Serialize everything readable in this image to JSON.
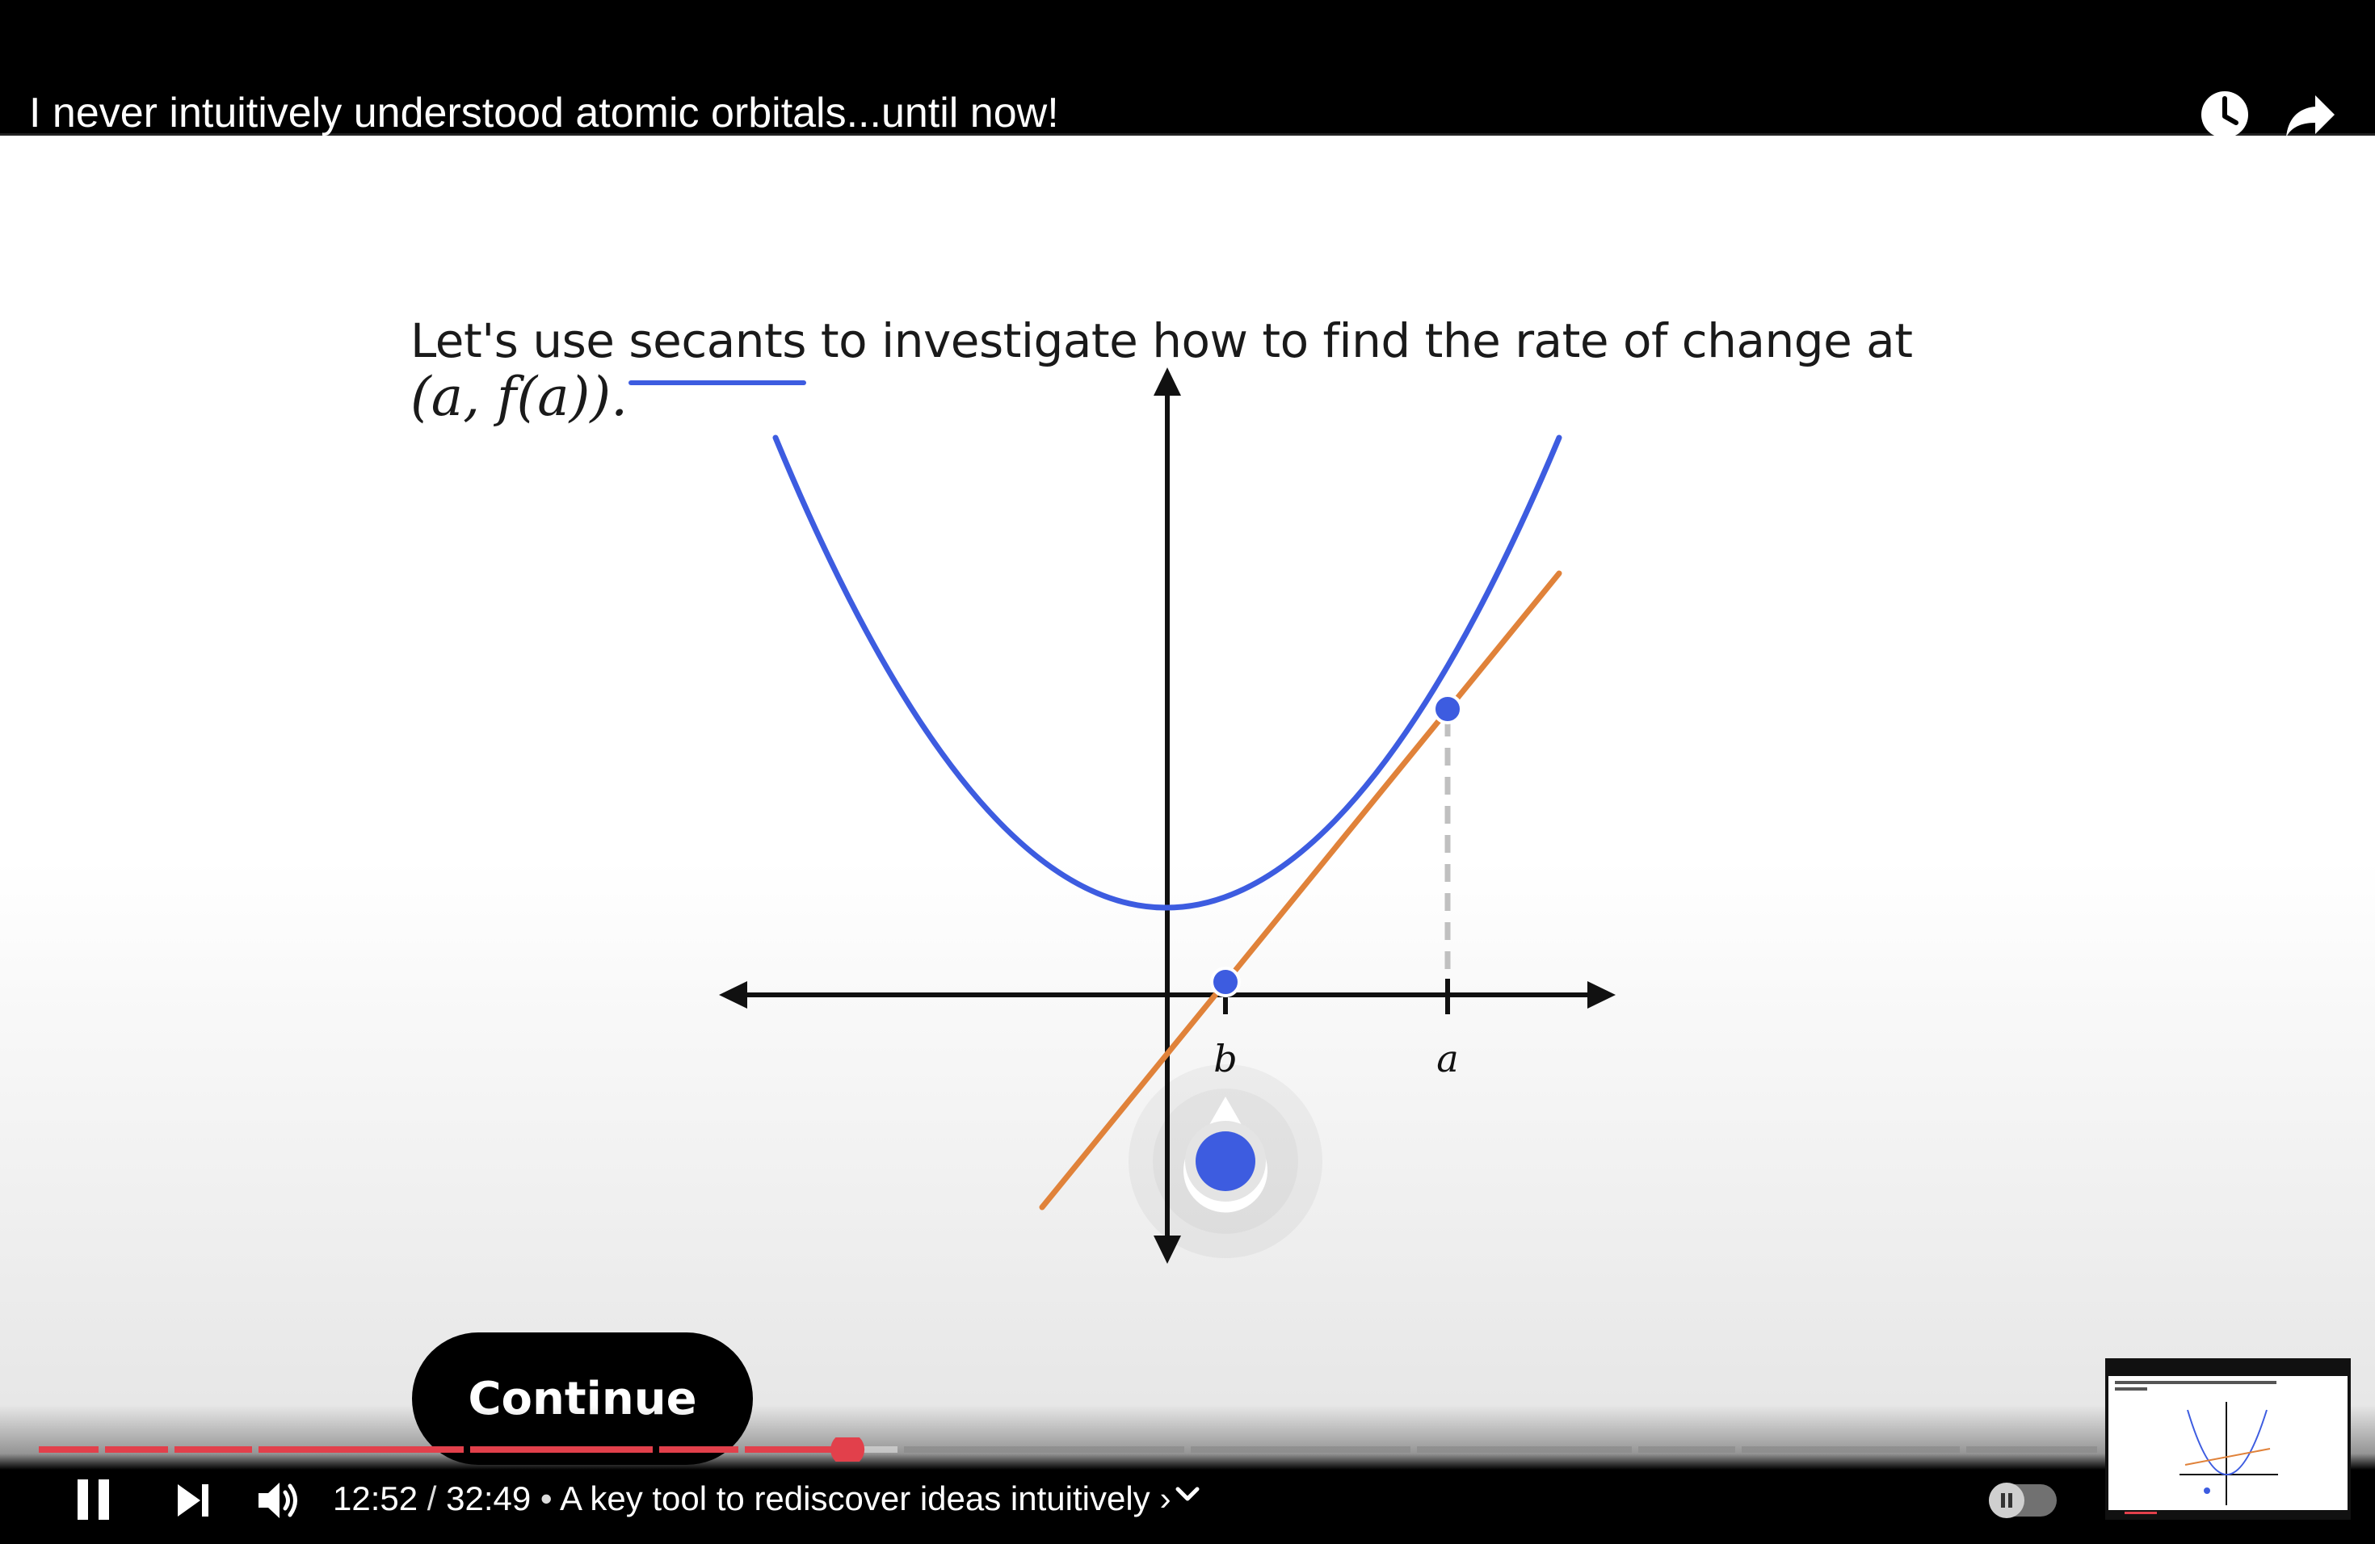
{
  "video": {
    "title": "I never intuitively understood atomic orbitals...until now!"
  },
  "icons": {
    "watch_later": "clock-icon",
    "share": "share-arrow-icon",
    "pause": "pause-icon",
    "next": "next-icon",
    "volume": "volume-icon",
    "chapter_chevron": "chevron-down-icon",
    "autoplay": "autoplay-toggle"
  },
  "lesson": {
    "text_before": "Let's use ",
    "term": "secants",
    "text_after": " to investigate how to find the rate of change at",
    "formula": "(a, f(a))."
  },
  "graph": {
    "label_b": "b",
    "label_a": "a"
  },
  "buttons": {
    "continue": "Continue"
  },
  "player": {
    "current_time": "12:52",
    "separator": " / ",
    "duration": "32:49",
    "bullet": " • ",
    "chapter": "A key tool to rediscover ideas intuitively",
    "chapter_arrow": "›",
    "progress_fraction": 0.3923
  },
  "colors": {
    "curve": "#3d5ce0",
    "secant": "#e0823a",
    "progress_played": "#e2404b",
    "progress_buffered": "#8a8a8a"
  }
}
